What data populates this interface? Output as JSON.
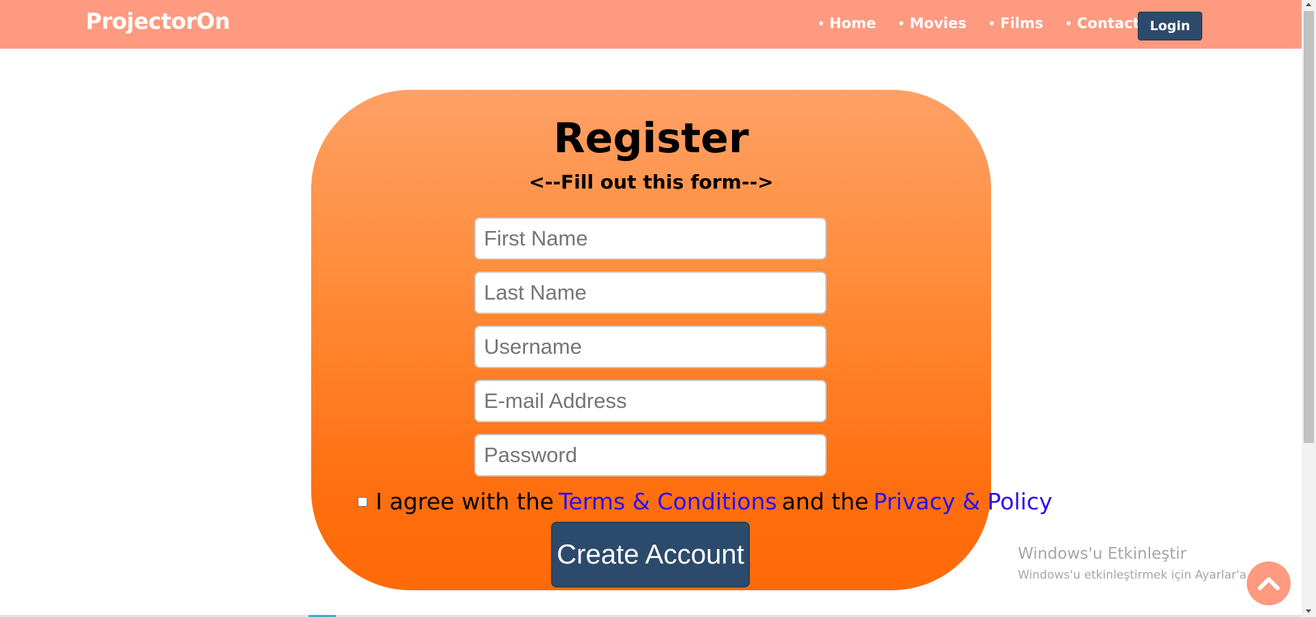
{
  "nav": {
    "brand": "ProjectorOn",
    "links": [
      "Home",
      "Movies",
      "Films",
      "Contact"
    ],
    "login_label": "Login"
  },
  "form": {
    "title": "Register",
    "subtitle": "<--Fill out this form-->",
    "placeholders": {
      "first_name": "First Name",
      "last_name": "Last Name",
      "username": "Username",
      "email": "E-mail Address",
      "password": "Password"
    },
    "agree_prefix": "I agree with the",
    "terms_link": "Terms & Conditions",
    "agree_middle": "and the",
    "privacy_link": "Privacy & Policy",
    "submit_label": "Create Account"
  },
  "watermark": {
    "title": "Windows'u Etkinleştir",
    "subtitle": "Windows'u etkinleştirmek için Ayarlar'a gidin."
  },
  "colors": {
    "navbar": "#fd9a80",
    "button": "#2c4a6c",
    "card_top": "#ffa066",
    "card_bottom": "#ff6a08",
    "link": "#2a0ff5"
  },
  "icons": {
    "back_to_top": "chevron-up-icon"
  }
}
